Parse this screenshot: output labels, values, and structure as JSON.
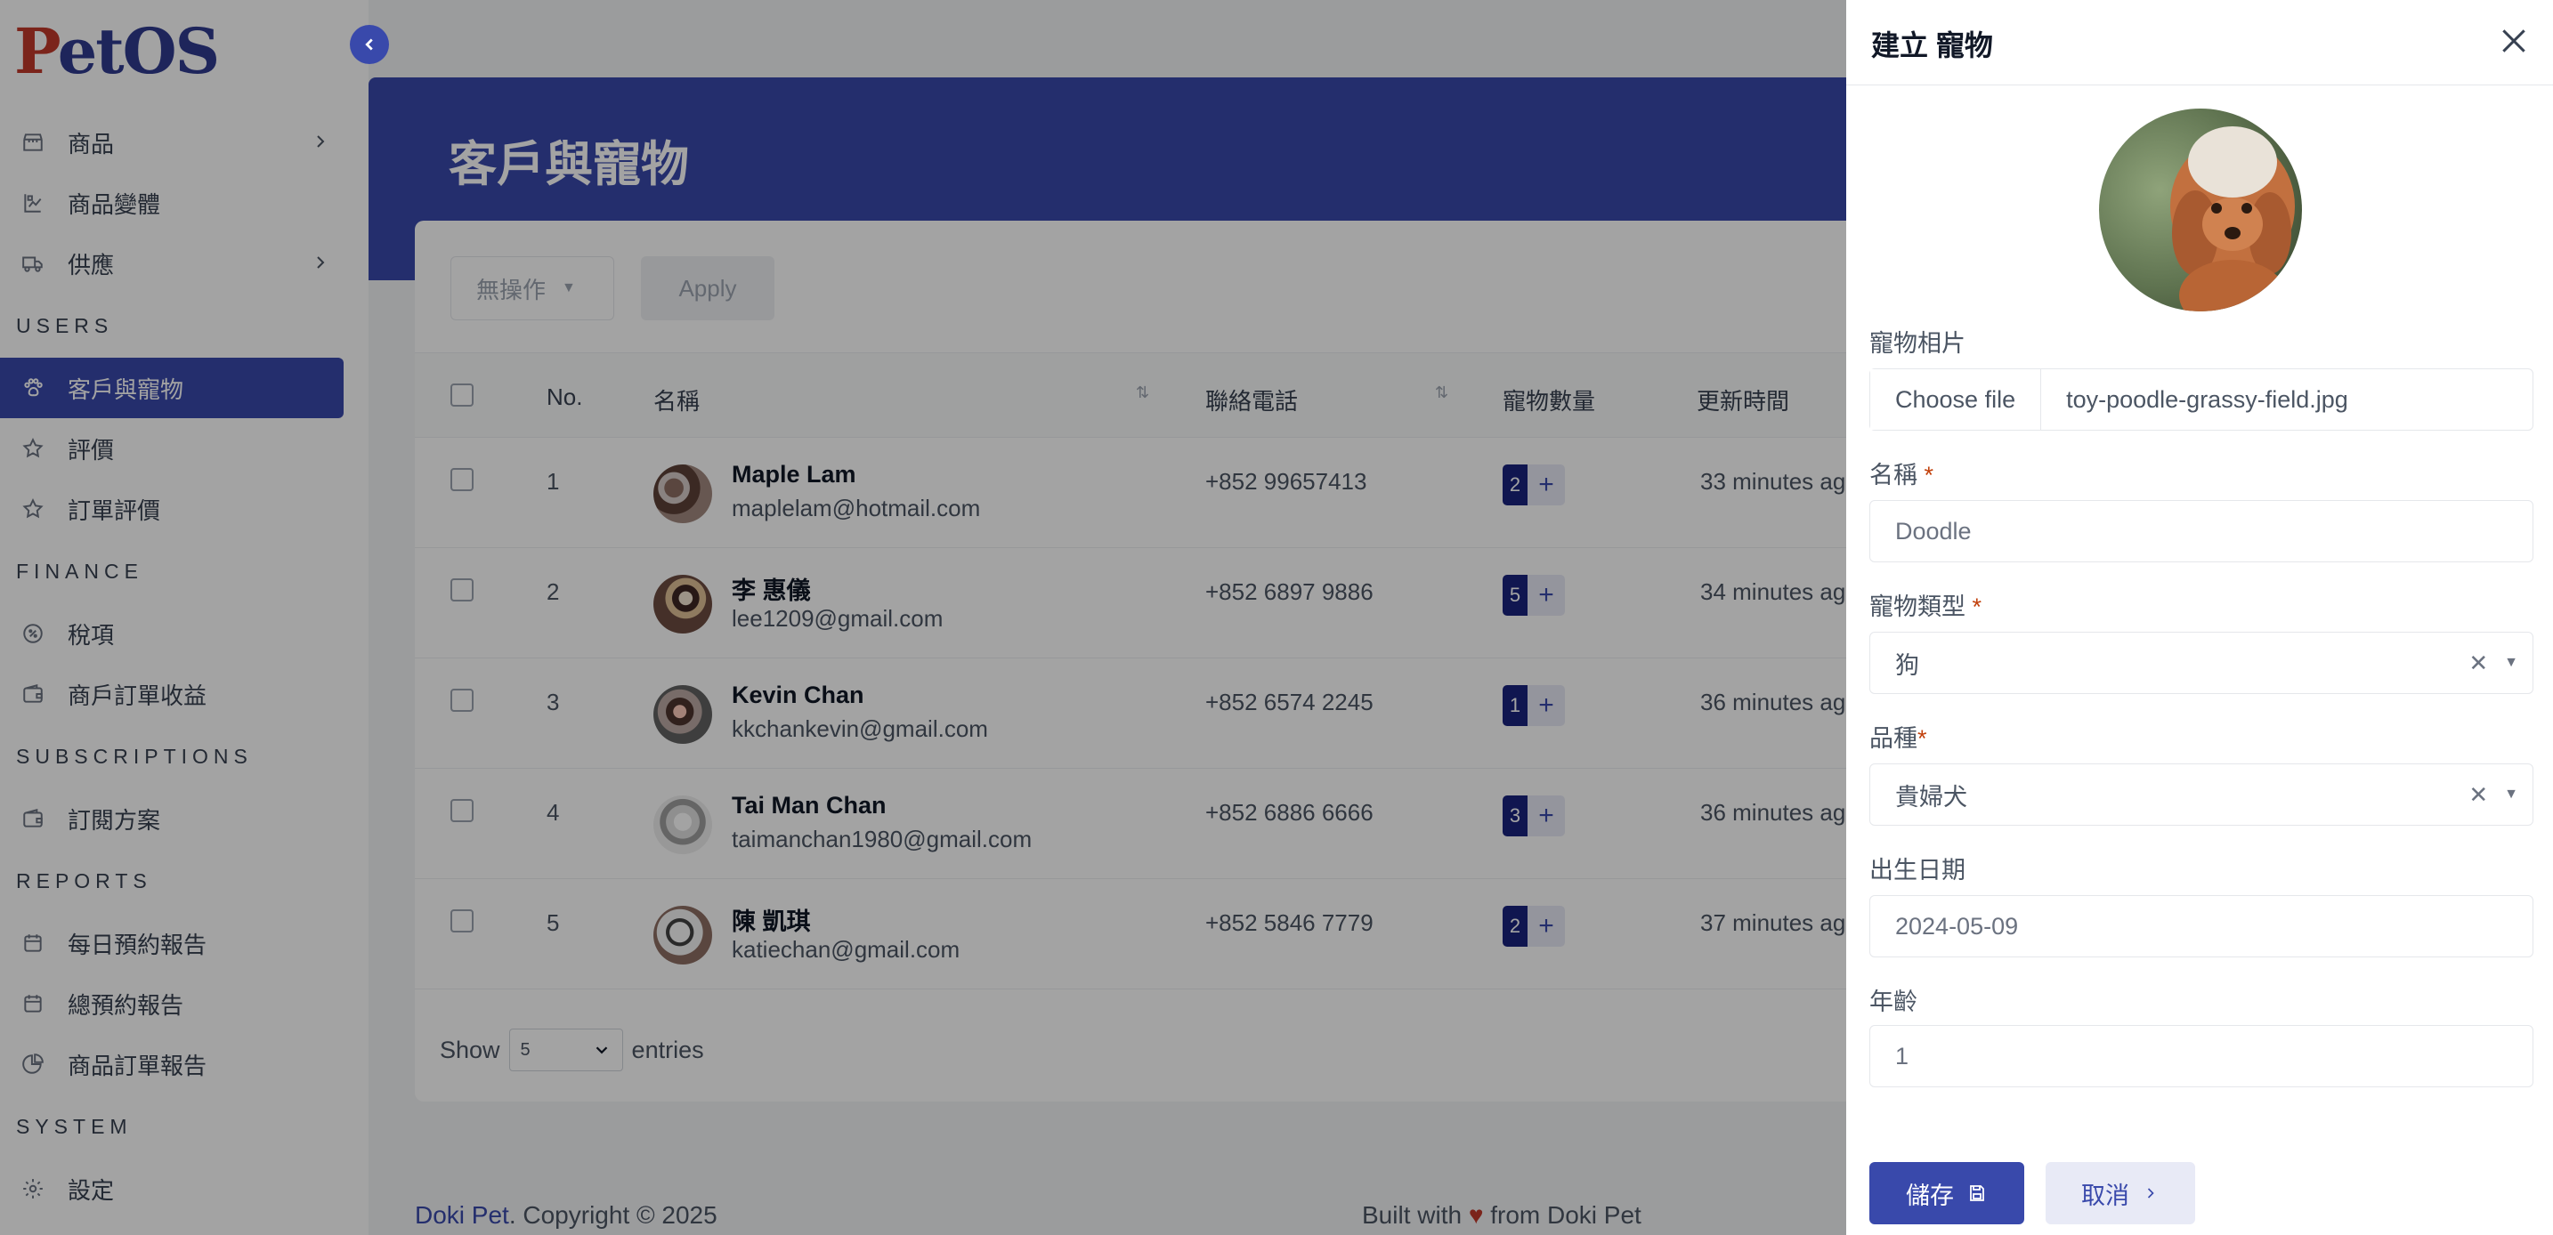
{
  "brand": {
    "logo_p": "P",
    "logo_rest": "etOS"
  },
  "sidebar": {
    "items": [
      {
        "label": "商品",
        "icon": "store-icon",
        "chevron": true
      },
      {
        "label": "商品變體",
        "icon": "variants-icon",
        "chevron": false
      },
      {
        "label": "供應",
        "icon": "truck-icon",
        "chevron": true
      }
    ],
    "sections": {
      "users": "USERS",
      "finance": "FINANCE",
      "subscriptions": "SUBSCRIPTIONS",
      "reports": "REPORTS",
      "system": "SYSTEM"
    },
    "users_items": [
      {
        "label": "客戶與寵物",
        "icon": "paw-icon",
        "active": true
      },
      {
        "label": "評價",
        "icon": "star-icon"
      },
      {
        "label": "訂單評價",
        "icon": "star-icon"
      }
    ],
    "finance_items": [
      {
        "label": "稅項",
        "icon": "tax-icon"
      },
      {
        "label": "商戶訂單收益",
        "icon": "wallet-icon"
      }
    ],
    "subscription_items": [
      {
        "label": "訂閱方案",
        "icon": "wallet-icon"
      }
    ],
    "report_items": [
      {
        "label": "每日預約報告",
        "icon": "calendar-icon"
      },
      {
        "label": "總預約報告",
        "icon": "calendar-icon"
      },
      {
        "label": "商品訂單報告",
        "icon": "pie-chart-icon"
      }
    ],
    "system_items": [
      {
        "label": "設定",
        "icon": "gear-icon"
      }
    ]
  },
  "page": {
    "title": "客戶與寵物"
  },
  "toolbar": {
    "bulk_action": "無操作",
    "apply_label": "Apply"
  },
  "table": {
    "headers": {
      "no": "No.",
      "name": "名稱",
      "phone": "聯絡電話",
      "pets": "寵物數量",
      "updated": "更新時間"
    },
    "rows": [
      {
        "no": "1",
        "name": "Maple Lam",
        "email": "maplelam@hotmail.com",
        "phone": "+852 99657413",
        "pets": "2",
        "updated": "33 minutes ago"
      },
      {
        "no": "2",
        "name": "李 惠儀",
        "email": "lee1209@gmail.com",
        "phone": "+852 6897 9886",
        "pets": "5",
        "updated": "34 minutes ago"
      },
      {
        "no": "3",
        "name": "Kevin Chan",
        "email": "kkchankevin@gmail.com",
        "phone": "+852 6574 2245",
        "pets": "1",
        "updated": "36 minutes ago"
      },
      {
        "no": "4",
        "name": "Tai Man Chan",
        "email": "taimanchan1980@gmail.com",
        "phone": "+852 6886 6666",
        "pets": "3",
        "updated": "36 minutes ago"
      },
      {
        "no": "5",
        "name": "陳 凱琪",
        "email": "katiechan@gmail.com",
        "phone": "+852 5846 7779",
        "pets": "2",
        "updated": "37 minutes ago"
      }
    ],
    "show_label": "Show",
    "page_size": "5",
    "entries_label": "entries"
  },
  "footer": {
    "brand": "Doki Pet",
    "copyright": ". Copyright © 2025",
    "built_prefix": "Built with",
    "built_suffix": "from Doki Pet"
  },
  "drawer": {
    "title": "建立 寵物",
    "photo_label": "寵物相片",
    "choose_file": "Choose file",
    "file_name": "toy-poodle-grassy-field.jpg",
    "name_label": "名稱",
    "name_value": "Doodle",
    "type_label": "寵物類型",
    "type_value": "狗",
    "breed_label": "品種",
    "breed_value": "貴婦犬",
    "dob_label": "出生日期",
    "dob_value": "2024-05-09",
    "age_label": "年齡",
    "age_value": "1",
    "save_label": "儲存",
    "cancel_label": "取消"
  },
  "colors": {
    "accent": "#3949ab",
    "accent_dark": "#1a237e",
    "required": "#c2410c",
    "logo_red": "#c0392b"
  }
}
